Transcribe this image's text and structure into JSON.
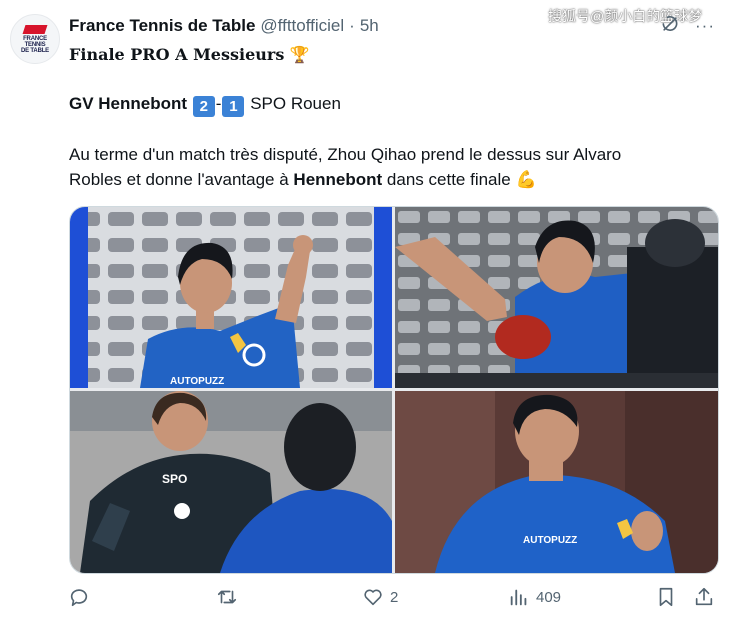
{
  "colors": {
    "accent": "#3b82d6",
    "text": "#0f1419",
    "muted": "#536471",
    "brand_red": "#d7142b"
  },
  "account": {
    "avatar_lines": [
      "FRANCE",
      "TENNIS",
      "DE TABLE"
    ],
    "name": "France Tennis de Table",
    "handle": "@ffttofficiel",
    "separator": "·",
    "time": "5h",
    "more_icon": "more-horizontal-icon"
  },
  "watermark": "搜狐号@颜小白的篮球梦",
  "tweet": {
    "title": "Finale PRO A Messieurs",
    "title_emoji": "🏆",
    "score": {
      "home_team": "GV Hennebont",
      "home_score": "2",
      "dash": "-",
      "away_score": "1",
      "away_team": "SPO Rouen"
    },
    "body_line1": "Au terme d'un match très disputé, Zhou Qihao prend le dessus sur Alvaro",
    "body_line2_prefix": "Robles et donne l'avantage à ",
    "body_line2_bold": "Hennebont",
    "body_line2_suffix": " dans cette finale ",
    "body_emoji": "💪"
  },
  "photo_text": {
    "p1_shirt": "AUTOPUZZ",
    "p3_club": "SPO",
    "p4_sponsor": "AUTOPUZZ"
  },
  "actions": {
    "reply_count": "",
    "repost_count": "",
    "like_count": "2",
    "views_count": "409"
  }
}
